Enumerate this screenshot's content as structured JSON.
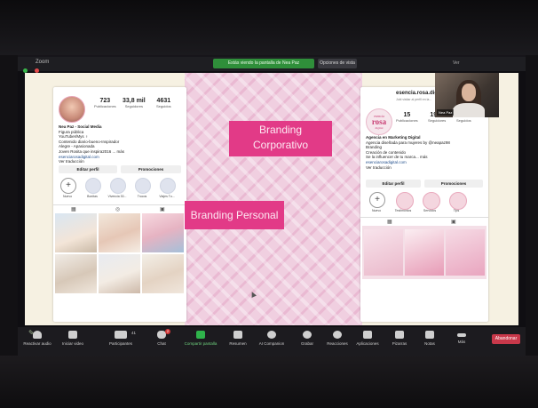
{
  "topbar": {
    "title": "Zoom",
    "share_banner": "Estás viendo la pantalla de Nea Paz",
    "view_options": "Opciones de vista",
    "right_text": "Ver"
  },
  "slide": {
    "label_corporativo_line1": "Branding",
    "label_corporativo_line2": "Corporativo",
    "label_personal": "Branding Personal"
  },
  "profile_left": {
    "posts": "723",
    "posts_label": "Publicaciones",
    "followers": "33,8 mil",
    "followers_label": "Seguidores",
    "following": "4631",
    "following_label": "Seguidos",
    "name": "Nea Paz - Social Media",
    "category": "Figura pública",
    "bio": [
      "YouTuber/Mys ♀",
      "Contenido diario-bueno-Inspirador",
      "Alegre - Apasionada",
      "Joven Rosita que inspira2016 ... más",
      "esenciarosadigital.com"
    ],
    "translate": "Ver traducción",
    "edit_profile": "Editar perfil",
    "promotions": "Promociones",
    "highlights": [
      "Nuevo",
      "Bonitas",
      "Vivencia 30...",
      "Trucos",
      "Viajes Tu..."
    ]
  },
  "profile_right": {
    "handle": "esencia.rosa.digital",
    "handle_sub": "Jubi visitar al perfil en la...",
    "logo_line1": "esencia",
    "logo_line2": "rosa",
    "logo_line3": "digital",
    "posts": "15",
    "posts_label": "Publicaciones",
    "followers": "1952",
    "followers_label": "Seguidores",
    "following": "18",
    "following_label": "Seguidos",
    "bio": [
      "Agencia en Marketing Digital",
      "Agencia diseñada para mujeres by @neapaz98",
      "Branding",
      "Creación de contenido",
      "Se la influencer de tu marca... más",
      "esenciarosadigital.com"
    ],
    "translate": "Ver traducción",
    "edit_profile": "Editar perfil",
    "promotions": "Promociones",
    "highlights": [
      "Nuevo",
      "Testimonios",
      "Servicios",
      "Tips"
    ]
  },
  "webcam": {
    "name": "Nea Paz"
  },
  "toolbar": {
    "audio": "Reactivar audio",
    "video": "Iniciar video",
    "participants": "Participantes",
    "participants_count": "41",
    "chat": "Chat",
    "chat_badge": "2",
    "share": "Compartir pantalla",
    "summary": "Resumen",
    "ai_companion": "AI Companion",
    "record": "Grabar",
    "reactions": "Reacciones",
    "apps": "Aplicaciones",
    "whiteboards": "Pizarras",
    "notes": "Notas",
    "more": "Más",
    "end": "Abandonar"
  },
  "colors": {
    "brand_pink": "#e23a87",
    "slide_bg": "#f6f1e2",
    "zoom_share_green": "#2f8f3a",
    "leave_red": "#c8384a"
  }
}
